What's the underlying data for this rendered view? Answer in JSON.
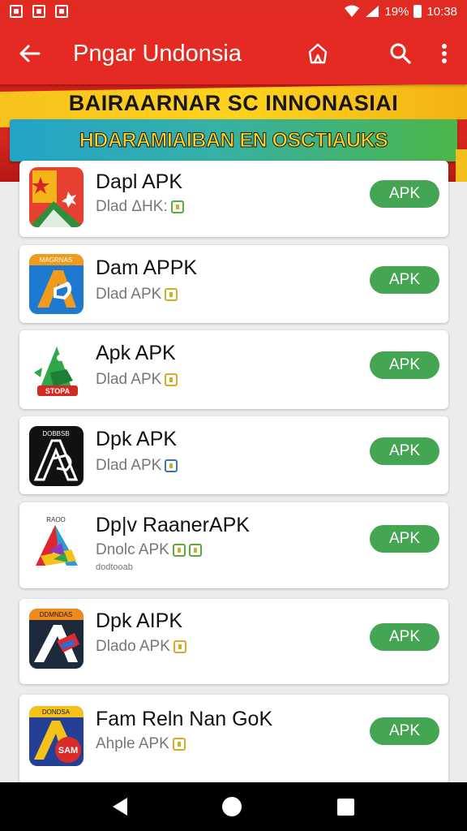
{
  "status_bar": {
    "battery": "19%",
    "time": "10:38"
  },
  "app_bar": {
    "title": "Pngar Undonsia",
    "back_icon": "arrow-left-icon",
    "home_icon": "home-outline-icon",
    "search_icon": "search-icon",
    "more_icon": "more-vert-icon"
  },
  "banner": {
    "title": "BAIRAARNAR SC INNONASIAI",
    "subtitle": "HDARAMIAIBAN EN OSCTIAUKS"
  },
  "apps": [
    {
      "name": "Dapl APK",
      "sub": "Dlad ΔΗΚ:",
      "button": "APK"
    },
    {
      "name": "Dam APPK",
      "sub": "Dlad APK",
      "button": "APK"
    },
    {
      "name": "Apk APK",
      "sub": "Dlad APK",
      "button": "APK"
    },
    {
      "name": "Dpk APK",
      "sub": "Dlad APK",
      "button": "APK"
    },
    {
      "name": "Dp|v RaanerAPK",
      "sub": "Dnolc APK",
      "extra": "dodtooab",
      "button": "APK"
    },
    {
      "name": "Dpk AIPK",
      "sub": "Dlado APK",
      "button": "APK"
    },
    {
      "name": "Fam Reln Nan GoK",
      "sub": "Ahple APK",
      "button": "APK"
    }
  ],
  "icons": {
    "app1": {
      "label": "",
      "colors": [
        "#e84030",
        "#f5b31c",
        "#2f8f3a"
      ]
    },
    "app2": {
      "label": "MAGRNAS",
      "colors": [
        "#1e7ad0",
        "#f19b1c"
      ]
    },
    "app3": {
      "label": "STOPA",
      "colors": [
        "#2fa74a",
        "#d42a24"
      ]
    },
    "app4": {
      "label": "DOBBSB",
      "colors": [
        "#111111",
        "#ffffff"
      ]
    },
    "app5": {
      "label": "RAOO",
      "colors": [
        "#e0252f",
        "#2d9bd8",
        "#f5c21a"
      ]
    },
    "app6": {
      "label": "DDMNDAS",
      "colors": [
        "#1d2a3b",
        "#f08a1c",
        "#e02a2a"
      ]
    },
    "app7": {
      "label": "DONDSA",
      "colors": [
        "#253f94",
        "#f5c21c",
        "#d92c2a"
      ],
      "badge": "SAM"
    }
  },
  "nav": {
    "back_icon": "nav-back-icon",
    "home_icon": "nav-home-icon",
    "recents_icon": "nav-recents-icon"
  }
}
